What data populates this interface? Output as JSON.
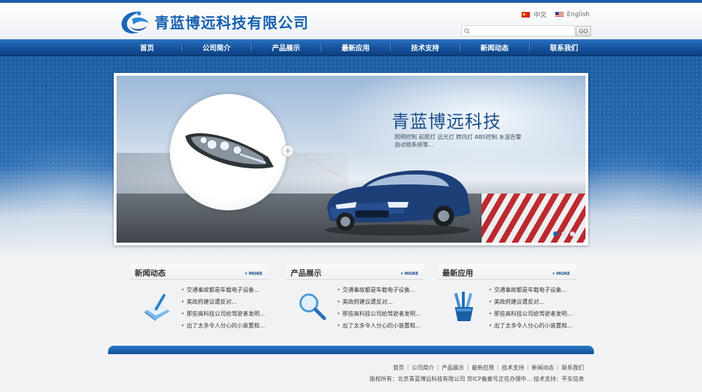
{
  "header": {
    "company_name": "青蓝博远科技有限公司",
    "languages": [
      {
        "label": "中文"
      },
      {
        "label": "English"
      }
    ],
    "search_placeholder": "",
    "go_label": "GO"
  },
  "nav": {
    "items": [
      "首页",
      "公司简介",
      "产品展示",
      "最新应用",
      "技术支持",
      "新闻动态",
      "联系我们"
    ]
  },
  "banner": {
    "title": "青蓝博远科技",
    "desc_line1": "照明控制   前照灯   远光灯   转向灯   ABS控制   水温告警",
    "desc_line2": "自动锁系统等...",
    "slides": 3,
    "active_slide": 1
  },
  "panels": [
    {
      "title": "新闻动态",
      "more": "MORE",
      "items": [
        "交通事故都是车载电子设备...",
        "美政府建议遭反对...",
        "那些高科技公司给驾驶者发明...",
        "出了太多令人分心的小装置和..."
      ]
    },
    {
      "title": "产品展示",
      "more": "MORE",
      "items": [
        "交通事故都是车载电子设备...",
        "美政府建议遭反对...",
        "那些高科技公司给驾驶者发明...",
        "出了太多令人分心的小装置和..."
      ]
    },
    {
      "title": "最新应用",
      "more": "MORE",
      "items": [
        "交通事故都是车载电子设备...",
        "美政府建议遭反对...",
        "那些高科技公司给驾驶者发明...",
        "出了太多令人分心的小装置和..."
      ]
    }
  ],
  "footer": {
    "links": [
      "首页",
      "公司简介",
      "产品展示",
      "最新应用",
      "技术支持",
      "新闻动态",
      "联系我们"
    ],
    "copyright": "版权所有：北京青蓝博远科技有限公司  京ICP备案号正在办理中...  技术支持：平东信息"
  },
  "colors": {
    "brand": "#1760b0",
    "nav": "#14509a",
    "accent_red": "#c8242b"
  }
}
